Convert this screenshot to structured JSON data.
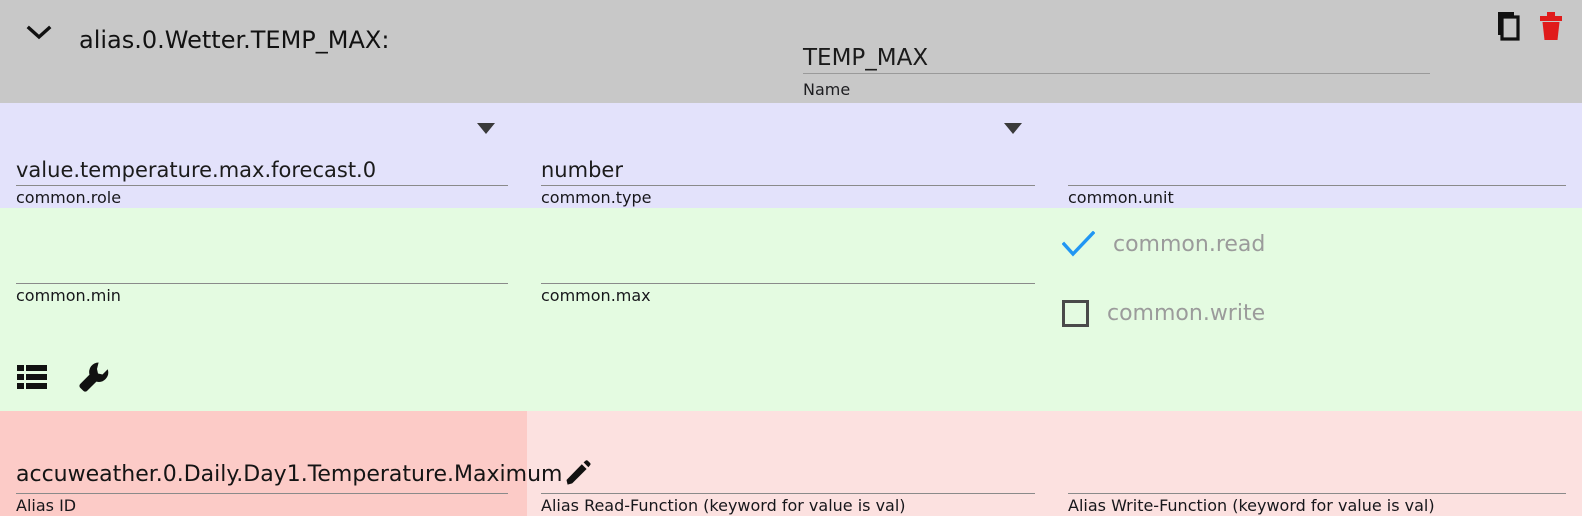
{
  "header": {
    "expand_icon": "chevron-down-icon",
    "object_id": "alias.0.Wetter.TEMP_MAX:",
    "name_field": {
      "value": "TEMP_MAX",
      "label": "Name"
    },
    "actions": [
      {
        "name": "copy-icon",
        "title": "Copy"
      },
      {
        "name": "delete-icon",
        "title": "Delete"
      }
    ]
  },
  "common": {
    "role": {
      "value": "value.temperature.max.forecast.0",
      "label": "common.role"
    },
    "type": {
      "value": "number",
      "label": "common.type"
    },
    "unit": {
      "value": "",
      "label": "common.unit"
    }
  },
  "limits": {
    "min": {
      "value": "",
      "label": "common.min"
    },
    "max": {
      "value": "",
      "label": "common.max"
    },
    "read": {
      "label": "common.read",
      "checked": true
    },
    "write": {
      "label": "common.write",
      "checked": false
    },
    "tools": [
      {
        "name": "list-icon"
      },
      {
        "name": "wrench-icon"
      }
    ]
  },
  "alias": {
    "id": {
      "value": "accuweather.0.Daily.Day1.Temperature.Maximum",
      "label": "Alias ID",
      "edit_icon": "pencil-icon"
    },
    "read_function": {
      "value": "",
      "label": "Alias Read-Function (keyword for value is val)"
    },
    "write_function": {
      "value": "",
      "label": "Alias Write-Function (keyword for value is val)"
    }
  },
  "colors": {
    "header_bg": "#c8c8c8",
    "common_bg": "#e3e2fb",
    "limits_bg": "#e4fbe1",
    "alias_bg": "#fce1e0",
    "alias_id_bg": "#fccbc7",
    "check_blue": "#2196f3",
    "delete_red": "#e01b1b",
    "muted_text": "#9b9b9b"
  }
}
